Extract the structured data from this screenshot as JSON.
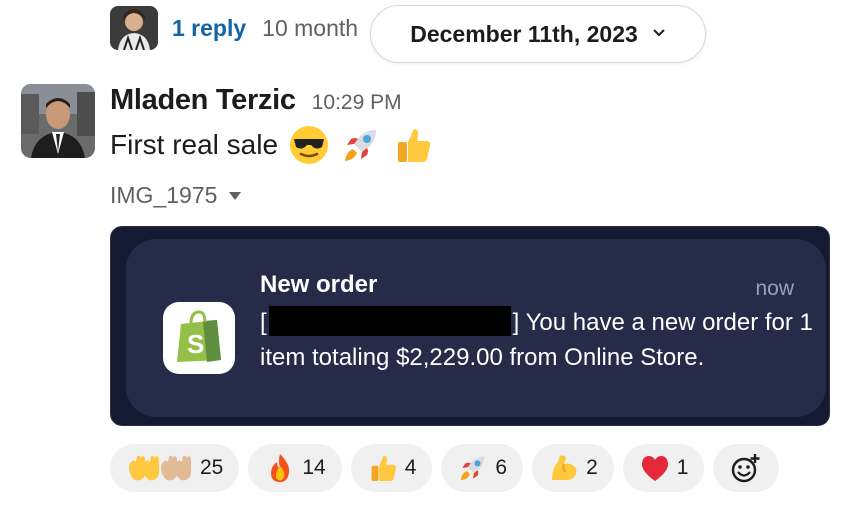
{
  "thread": {
    "reply_label": "1 reply",
    "reply_time": "10 month"
  },
  "date_pill": {
    "label": "December 11th, 2023"
  },
  "message": {
    "author": "Mladen Terzic",
    "time": "10:29 PM",
    "text": "First real sale",
    "emojis": [
      "sunglasses-emoji",
      "rocket-emoji",
      "thumbs-up-emoji"
    ]
  },
  "attachment": {
    "file_name": "IMG_1975",
    "notification": {
      "title": "New order",
      "time": "now",
      "body_prefix": "[",
      "body_after_redact": "] You have a new order for 1 item totaling $2,229.00 from Online Store."
    }
  },
  "reactions": [
    {
      "icon": "raised-hands-emoji",
      "count": "25"
    },
    {
      "icon": "fire-emoji",
      "count": "14"
    },
    {
      "icon": "thumbs-up-emoji",
      "count": "4"
    },
    {
      "icon": "rocket-emoji",
      "count": "6"
    },
    {
      "icon": "flexed-biceps-emoji",
      "count": "2"
    },
    {
      "icon": "red-heart-emoji",
      "count": "1"
    }
  ],
  "colors": {
    "link": "#1264a3",
    "muted": "#616061",
    "notif_bg": "#252b48",
    "shopify_green": "#95bf47"
  }
}
